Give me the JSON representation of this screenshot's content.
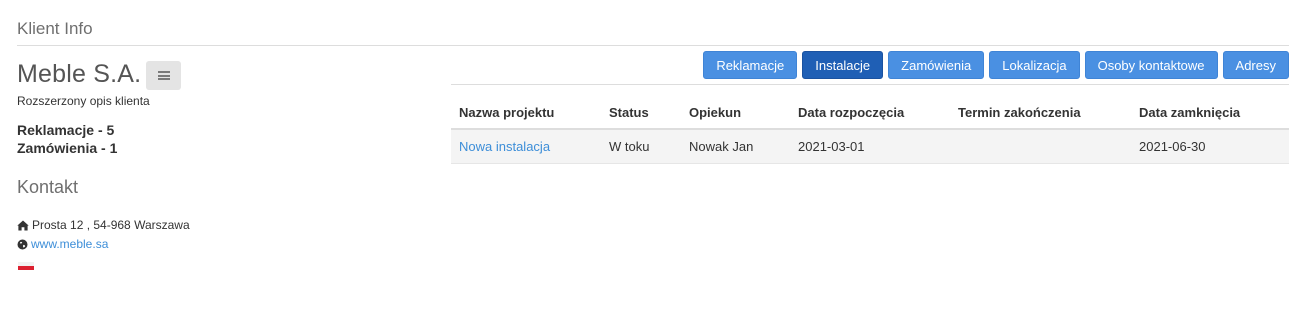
{
  "header": {
    "title": "Klient Info"
  },
  "client": {
    "name": "Meble S.A.",
    "description": "Rozszerzony opis klienta",
    "complaints_line": "Reklamacje - 5",
    "orders_line": "Zamówienia - 1"
  },
  "contact": {
    "title": "Kontakt",
    "address": "Prosta 12 , 54-968 Warszawa",
    "website": "www.meble.sa",
    "country_flag": "PL"
  },
  "tabs": [
    {
      "label": "Reklamacje",
      "active": false
    },
    {
      "label": "Instalacje",
      "active": true
    },
    {
      "label": "Zamówienia",
      "active": false
    },
    {
      "label": "Lokalizacja",
      "active": false
    },
    {
      "label": "Osoby kontaktowe",
      "active": false
    },
    {
      "label": "Adresy",
      "active": false
    }
  ],
  "table": {
    "columns": [
      "Nazwa projektu",
      "Status",
      "Opiekun",
      "Data rozpoczęcia",
      "Termin zakończenia",
      "Data zamknięcia"
    ],
    "rows": [
      {
        "project_name": "Nowa instalacja",
        "status": "W toku",
        "manager": "Nowak Jan",
        "start_date": "2021-03-01",
        "due_date": "",
        "close_date": "2021-06-30"
      }
    ]
  },
  "icons": {
    "menu": "menu-icon",
    "address": "home-icon",
    "website": "globe-icon",
    "flag": "flag-poland-icon"
  },
  "colors": {
    "tab_button": "#4a90e2",
    "tab_button_active": "#1f5fb5",
    "link": "#3d8ed8",
    "flag_red": "#dc2030"
  }
}
